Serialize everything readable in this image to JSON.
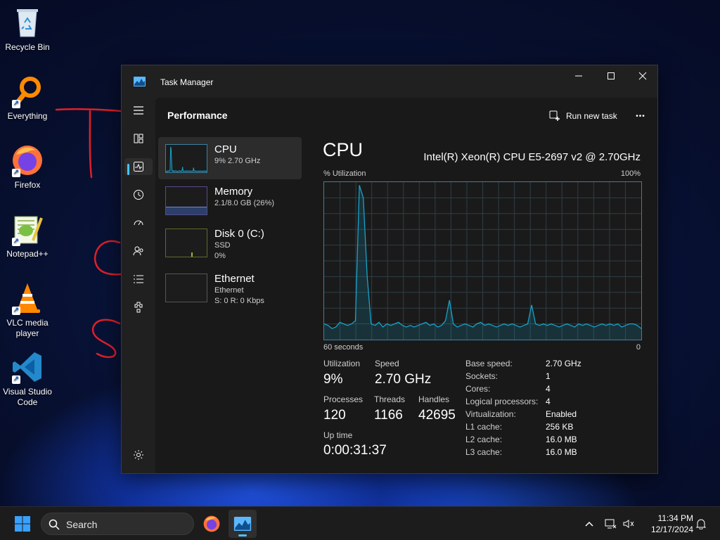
{
  "desktop": {
    "icons": [
      {
        "label": "Recycle Bin"
      },
      {
        "label": "Everything"
      },
      {
        "label": "Firefox"
      },
      {
        "label": "Notepad++"
      },
      {
        "label": "VLC media player"
      },
      {
        "label": "Visual Studio Code"
      }
    ]
  },
  "window": {
    "title": "Task Manager",
    "page_title": "Performance",
    "run_new_task_label": "Run new task",
    "more_label": "•••",
    "nav_icons": [
      "processes-icon",
      "performance-icon",
      "app-history-icon",
      "startup-apps-icon",
      "users-icon",
      "details-icon",
      "services-icon",
      "settings-icon"
    ],
    "active_nav": "performance-icon"
  },
  "resources": [
    {
      "name": "CPU",
      "sub1": "9% 2.70 GHz",
      "active": true
    },
    {
      "name": "Memory",
      "sub1": "2.1/8.0 GB (26%)"
    },
    {
      "name": "Disk 0 (C:)",
      "sub1": "SSD",
      "sub2": "0%"
    },
    {
      "name": "Ethernet",
      "sub1": "Ethernet",
      "sub2": "S: 0 R: 0 Kbps"
    }
  ],
  "cpu": {
    "title": "CPU",
    "model": "Intel(R) Xeon(R) CPU E5-2697 v2 @ 2.70GHz",
    "graph_label": "% Utilization",
    "graph_max": "100%",
    "graph_span": "60 seconds",
    "graph_min": "0",
    "stats": {
      "utilization_label": "Utilization",
      "utilization": "9%",
      "speed_label": "Speed",
      "speed": "2.70 GHz",
      "processes_label": "Processes",
      "processes": "120",
      "threads_label": "Threads",
      "threads": "1166",
      "handles_label": "Handles",
      "handles": "42695",
      "uptime_label": "Up time",
      "uptime": "0:00:31:37"
    },
    "specs": [
      {
        "key": "Base speed:",
        "value": "2.70 GHz"
      },
      {
        "key": "Sockets:",
        "value": "1"
      },
      {
        "key": "Cores:",
        "value": "4"
      },
      {
        "key": "Logical processors:",
        "value": "4"
      },
      {
        "key": "Virtualization:",
        "value": "Enabled"
      },
      {
        "key": "L1 cache:",
        "value": "256 KB"
      },
      {
        "key": "L2 cache:",
        "value": "16.0 MB"
      },
      {
        "key": "L3 cache:",
        "value": "16.0 MB"
      }
    ],
    "history": [
      10,
      9,
      7,
      8,
      11,
      10,
      9,
      10,
      12,
      98,
      90,
      40,
      10,
      9,
      11,
      8,
      10,
      9,
      10,
      11,
      9,
      8,
      9,
      8,
      9,
      10,
      11,
      9,
      10,
      8,
      9,
      12,
      25,
      10,
      8,
      9,
      10,
      9,
      8,
      10,
      11,
      9,
      10,
      9,
      8,
      9,
      10,
      9,
      10,
      9,
      8,
      9,
      10,
      22,
      10,
      9,
      10,
      9,
      10,
      9,
      8,
      9,
      10,
      9,
      8,
      10,
      9,
      10,
      9,
      8,
      9,
      10,
      9,
      10,
      9,
      10,
      8,
      9,
      10,
      10,
      9,
      7
    ]
  },
  "taskbar": {
    "search_placeholder": "Search",
    "time": "11:34 PM",
    "date": "12/17/2024"
  },
  "colors": {
    "accent": "#4cc2ff",
    "graph_line": "#17a2c8"
  }
}
